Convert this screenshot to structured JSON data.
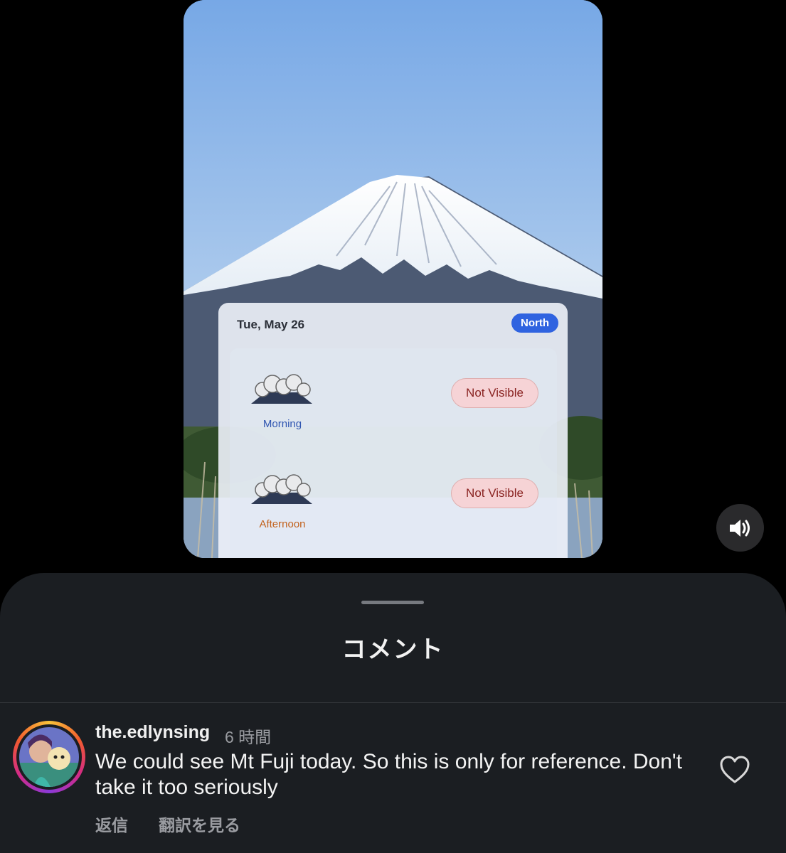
{
  "forecast": {
    "date": "Tue, May 26",
    "direction": "North",
    "periods": [
      {
        "label": "Morning",
        "status": "Not Visible",
        "label_color": "#2f55b0"
      },
      {
        "label": "Afternoon",
        "status": "Not Visible",
        "label_color": "#c2611c"
      }
    ]
  },
  "controls": {
    "sound_icon": "speaker-volume-icon"
  },
  "comments_sheet": {
    "title": "コメント",
    "comment": {
      "username": "the.edlynsing",
      "time": "6 時間",
      "text": "We could see Mt Fuji today. So this is only for reference. Don't take it too seriously",
      "reply_label": "返信",
      "translate_label": "翻訳を見る",
      "like_icon": "heart-outline-icon"
    }
  },
  "colors": {
    "accent": "#2f63e0",
    "sheet_bg": "#1b1e22",
    "not_visible_text": "#8a2422"
  }
}
